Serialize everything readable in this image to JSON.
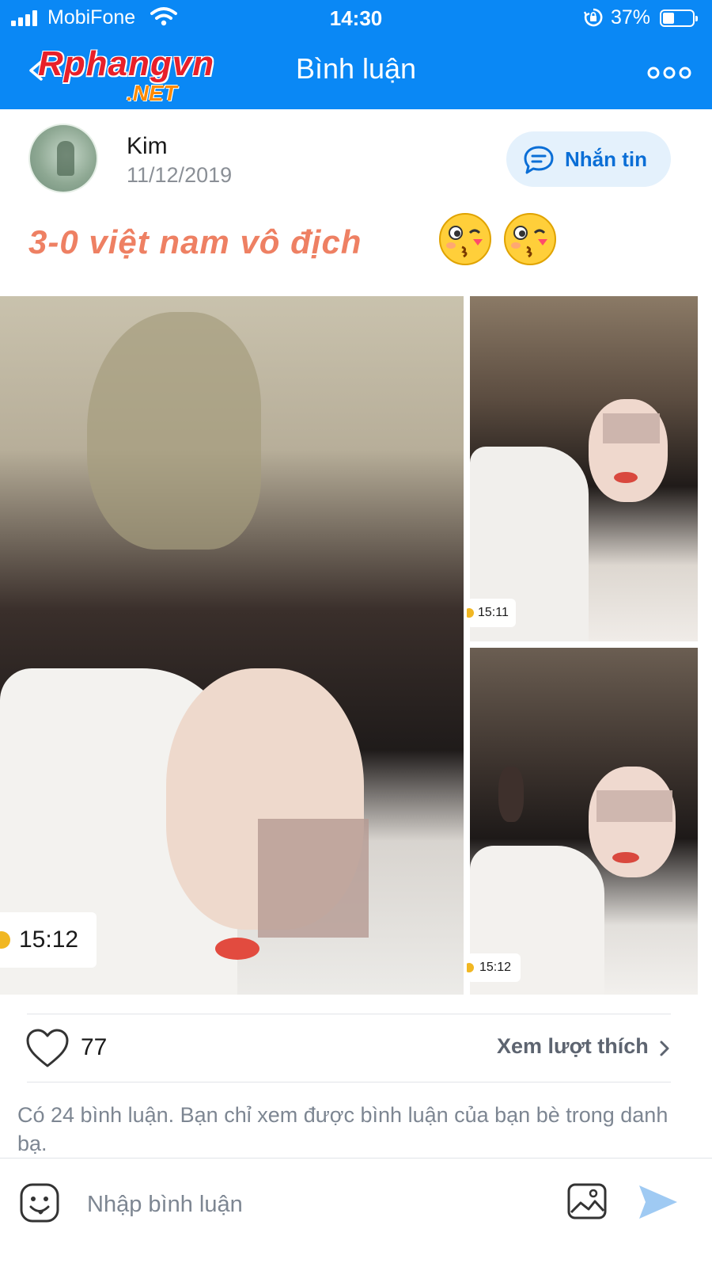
{
  "status_bar": {
    "carrier": "MobiFone",
    "time": "14:30",
    "battery": "37%"
  },
  "nav": {
    "logo_main": "Rphangvn",
    "logo_sub": ".NET",
    "title": "Bình luận"
  },
  "post": {
    "author": "Kim",
    "date": "11/12/2019",
    "message_button": "Nhắn tin",
    "caption": "3-0 việt nam vô địch",
    "photos": [
      {
        "time": "15:12"
      },
      {
        "time": "15:11"
      },
      {
        "time": "15:12"
      }
    ],
    "likes": "77",
    "view_likes": "Xem lượt thích",
    "comments_notice": "Có 24 bình luận. Bạn chỉ xem được bình luận của bạn bè trong danh bạ."
  },
  "composer": {
    "placeholder": "Nhập bình luận"
  },
  "colors": {
    "primary": "#0a88f5",
    "caption": "#ee8063",
    "link": "#0a6ed6"
  },
  "icons": [
    "signal-icon",
    "wifi-icon",
    "rotation-lock-icon",
    "battery-icon",
    "back-icon",
    "more-icon",
    "chat-bubble-icon",
    "kiss-emoji-icon",
    "clock-icon",
    "heart-icon",
    "chevron-right-icon",
    "smiley-icon",
    "image-icon",
    "send-icon"
  ]
}
